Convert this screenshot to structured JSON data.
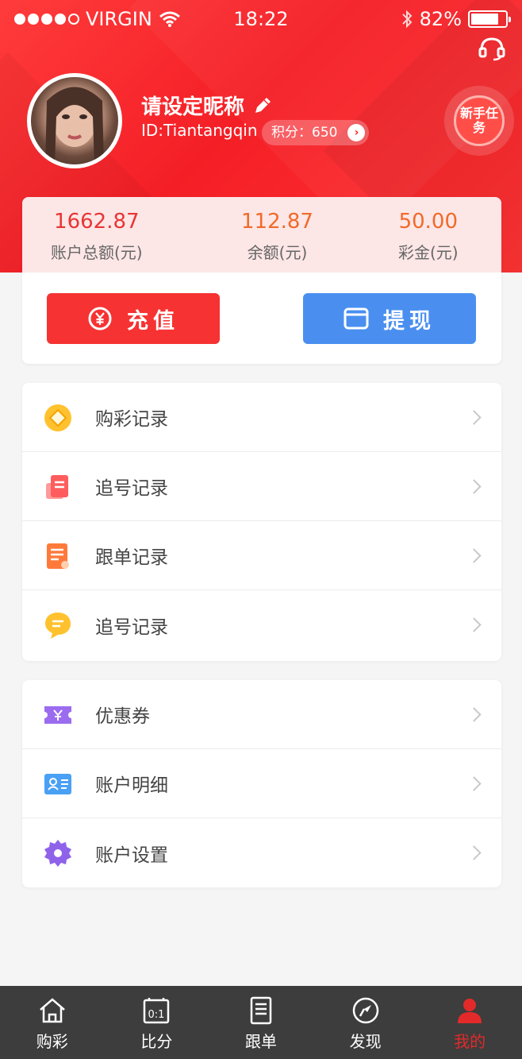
{
  "status_bar": {
    "carrier": "VIRGIN",
    "time": "18:22",
    "battery": "82%",
    "battery_level": 0.82
  },
  "profile": {
    "nickname": "请设定昵称",
    "user_id": "ID:Tiantangqin",
    "points_label": "积分：",
    "points_value": "650",
    "task_badge": "新手任务"
  },
  "balance": {
    "total_value": "1662.87",
    "total_label": "账户总额(元)",
    "balance_value": "112.87",
    "balance_label": "余额(元)",
    "bonus_value": "50.00",
    "bonus_label": "彩金(元)",
    "recharge_label": "充值",
    "withdraw_label": "提现"
  },
  "records": [
    {
      "label": "购彩记录",
      "icon": "diamond-coin-icon"
    },
    {
      "label": "追号记录",
      "icon": "document-red-icon"
    },
    {
      "label": "跟单记录",
      "icon": "notebook-orange-icon"
    },
    {
      "label": "追号记录",
      "icon": "chat-bubble-yellow-icon"
    }
  ],
  "account": [
    {
      "label": "优惠券",
      "icon": "coupon-icon"
    },
    {
      "label": "账户明细",
      "icon": "id-card-icon"
    },
    {
      "label": "账户设置",
      "icon": "settings-gear-icon"
    }
  ],
  "tabs": [
    {
      "label": "购彩",
      "icon": "home-icon"
    },
    {
      "label": "比分",
      "icon": "score-board-icon"
    },
    {
      "label": "跟单",
      "icon": "list-doc-icon"
    },
    {
      "label": "发现",
      "icon": "compass-icon"
    },
    {
      "label": "我的",
      "icon": "user-icon"
    }
  ],
  "colors": {
    "brand_red": "#f41f26",
    "recharge": "#f63232",
    "withdraw": "#4a8ff0",
    "tab_bar": "#3d3d3d"
  }
}
